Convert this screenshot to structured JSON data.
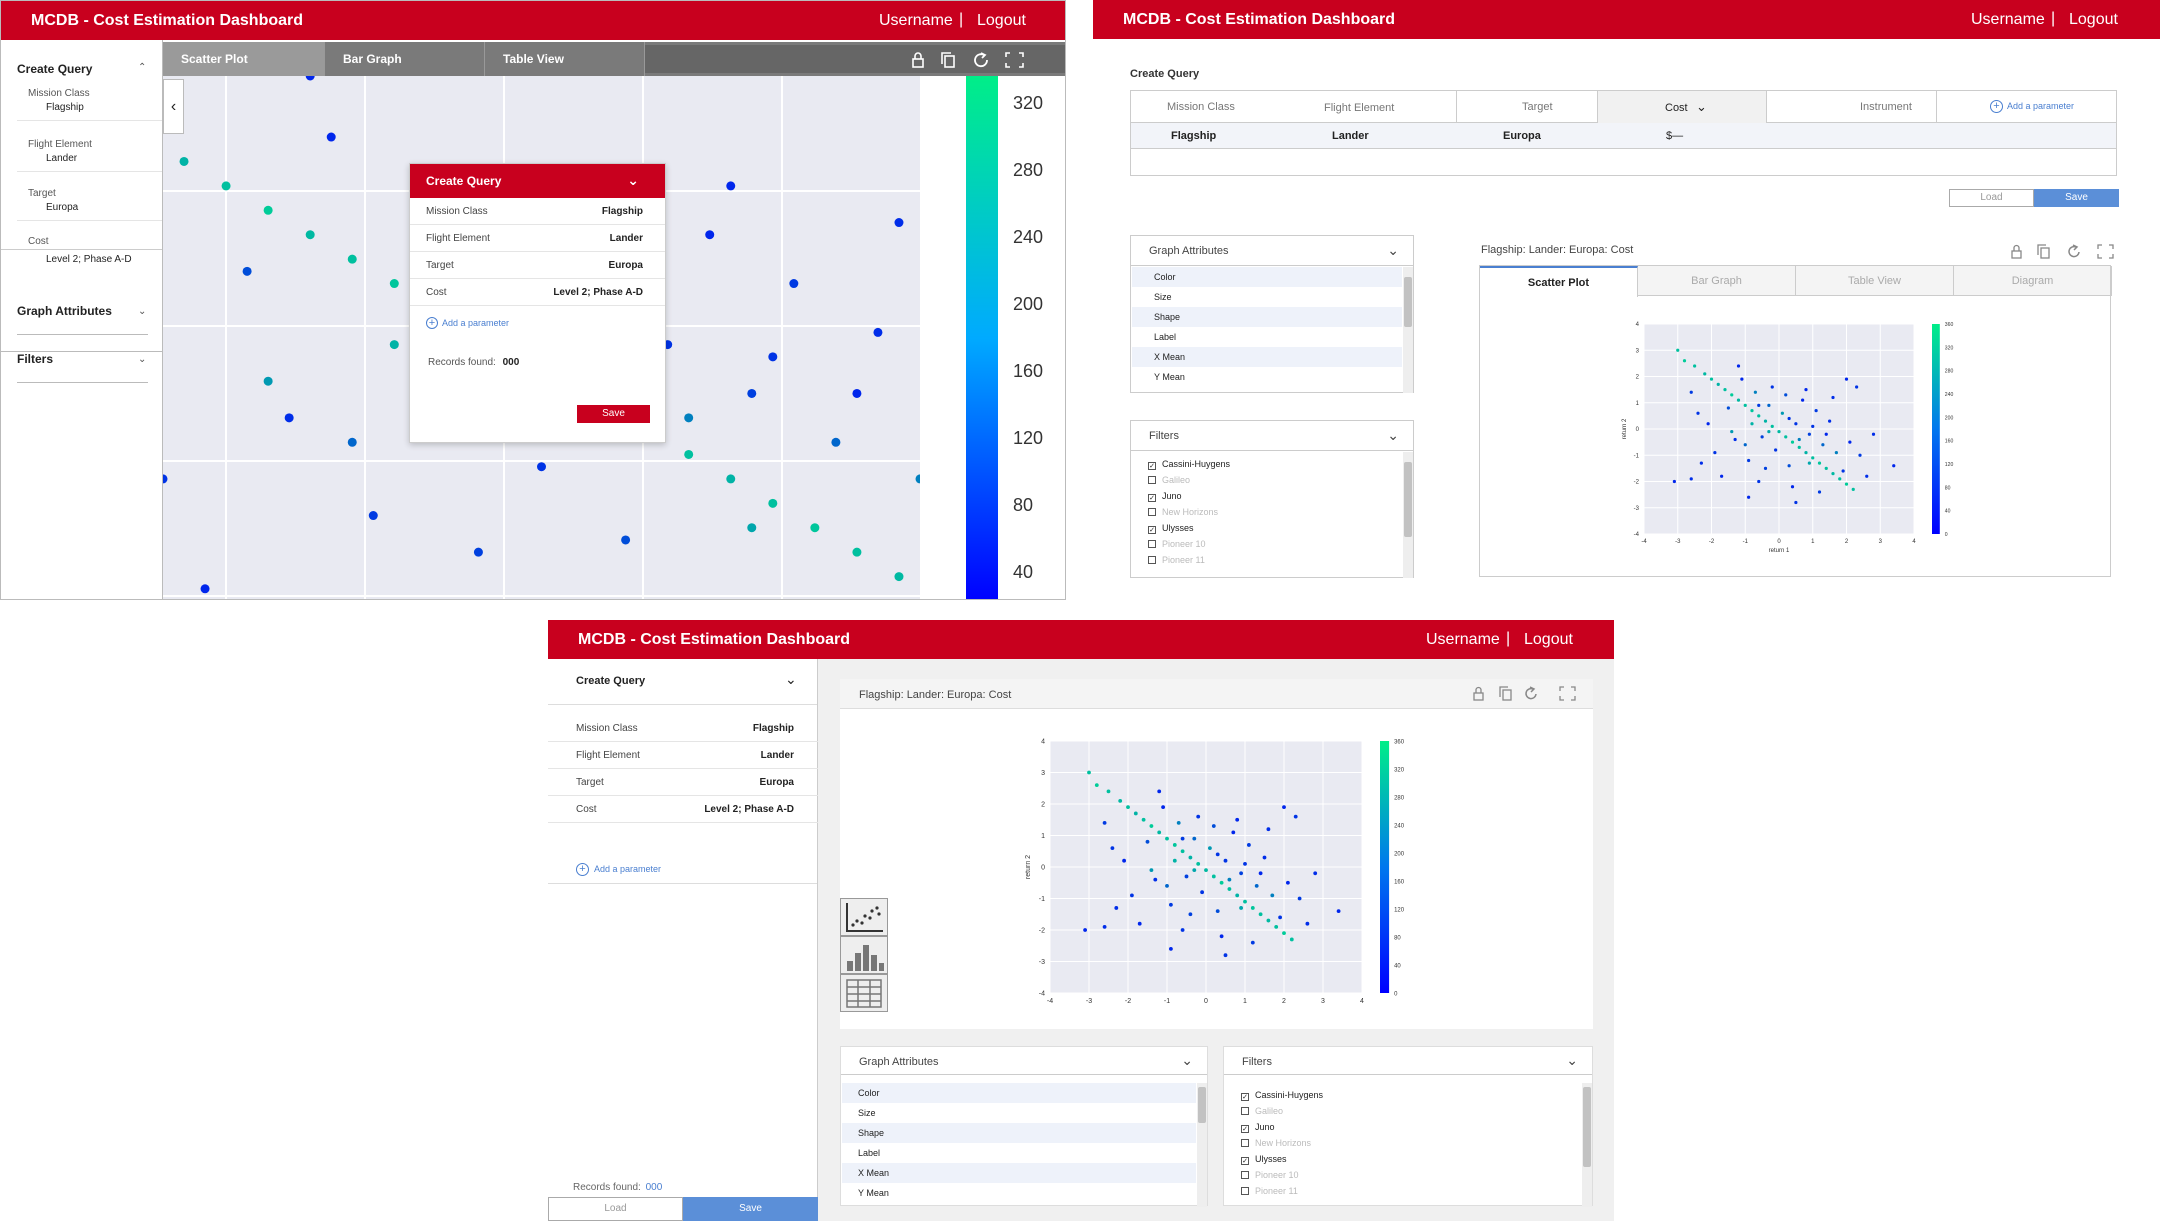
{
  "app": {
    "title": "MCDB - Cost Estimation Dashboard",
    "username": "Username",
    "logout": "Logout",
    "sep": "|"
  },
  "icons": [
    "lock-icon",
    "copy-icon",
    "refresh-icon",
    "fullscreen-icon",
    "chevron-down-icon",
    "chevron-up-icon",
    "chevron-left-icon",
    "plus-circle-icon",
    "scatter-plot-icon",
    "bar-graph-icon",
    "table-view-icon"
  ],
  "colors": {
    "brand": "#c8001e",
    "accent": "#5b8fd8",
    "cmap_low": "#0000ff",
    "cmap_high": "#00ee88"
  },
  "panel1": {
    "sidebar": {
      "create_query": "Create Query",
      "fields": [
        {
          "label": "Mission Class",
          "value": "Flagship"
        },
        {
          "label": "Flight Element",
          "value": "Lander"
        },
        {
          "label": "Target",
          "value": "Europa"
        },
        {
          "label": "Cost",
          "value": "Level 2; Phase A-D"
        }
      ],
      "graph_attributes": "Graph Attributes",
      "filters": "Filters"
    },
    "tabs": [
      "Scatter Plot",
      "Bar Graph",
      "Table View"
    ],
    "colorbar_ticks": [
      "320",
      "280",
      "240",
      "200",
      "160",
      "120",
      "80",
      "40"
    ],
    "popup": {
      "title": "Create Query",
      "rows": [
        {
          "label": "Mission Class",
          "value": "Flagship"
        },
        {
          "label": "Flight Element",
          "value": "Lander"
        },
        {
          "label": "Target",
          "value": "Europa"
        },
        {
          "label": "Cost",
          "value": "Level 2; Phase A-D"
        }
      ],
      "add_parameter": "Add a parameter",
      "records_label": "Records found:",
      "records_value": "000",
      "save": "Save"
    }
  },
  "panel2": {
    "create_query": "Create Query",
    "headers": [
      "Mission Class",
      "Flight Element",
      "Target",
      "Cost",
      "Instrument"
    ],
    "add_parameter": "Add a parameter",
    "row": [
      "Flagship",
      "Lander",
      "Europa",
      "$—"
    ],
    "load": "Load",
    "save": "Save",
    "graph_attributes": {
      "title": "Graph Attributes",
      "items": [
        "Color",
        "Size",
        "Shape",
        "Label",
        "X Mean",
        "Y Mean"
      ]
    },
    "filters": {
      "title": "Filters",
      "items": [
        {
          "label": "Cassini-Huygens",
          "checked": true
        },
        {
          "label": "Galileo",
          "checked": false
        },
        {
          "label": "Juno",
          "checked": true
        },
        {
          "label": "New Horizons",
          "checked": false
        },
        {
          "label": "Ulysses",
          "checked": true
        },
        {
          "label": "Pioneer 10",
          "checked": false
        },
        {
          "label": "Pioneer 11",
          "checked": false
        }
      ]
    },
    "chart_title": "Flagship:  Lander:  Europa:  Cost",
    "tabs": [
      "Scatter Plot",
      "Bar Graph",
      "Table View",
      "Diagram"
    ]
  },
  "panel3": {
    "create_query": "Create Query",
    "fields": [
      {
        "label": "Mission Class",
        "value": "Flagship"
      },
      {
        "label": "Flight Element",
        "value": "Lander"
      },
      {
        "label": "Target",
        "value": "Europa"
      },
      {
        "label": "Cost",
        "value": "Level 2; Phase A-D"
      }
    ],
    "add_parameter": "Add a parameter",
    "records_label": "Records found:",
    "records_value": "000",
    "load": "Load",
    "save": "Save",
    "chart_title": "Flagship:  Lander:  Europa:  Cost",
    "graph_attributes": {
      "title": "Graph Attributes",
      "items": [
        "Color",
        "Size",
        "Shape",
        "Label",
        "X Mean",
        "Y Mean"
      ]
    },
    "filters": {
      "title": "Filters",
      "items": [
        {
          "label": "Cassini-Huygens",
          "checked": true
        },
        {
          "label": "Galileo",
          "checked": false
        },
        {
          "label": "Juno",
          "checked": true
        },
        {
          "label": "New Horizons",
          "checked": false
        },
        {
          "label": "Ulysses",
          "checked": true
        },
        {
          "label": "Pioneer 10",
          "checked": false
        },
        {
          "label": "Pioneer 11",
          "checked": false
        }
      ]
    }
  },
  "chart_data": [
    {
      "type": "scatter",
      "xlabel": "return 1",
      "ylabel": "return 2",
      "xlim": [
        -4,
        4
      ],
      "ylim": [
        -4,
        4
      ],
      "xticks": [
        "-4",
        "-3",
        "-2",
        "-1",
        "0",
        "1",
        "2",
        "3",
        "4"
      ],
      "yticks": [
        "4",
        "3",
        "2",
        "1",
        "0",
        "-1",
        "-2",
        "-3",
        "-4"
      ],
      "color_scale": {
        "min": 0,
        "max": 360,
        "ticks": [
          "360",
          "320",
          "280",
          "240",
          "200",
          "160",
          "120",
          "80",
          "40",
          "0"
        ]
      },
      "grid": true,
      "points": [
        [
          -3.0,
          3.0,
          300
        ],
        [
          -2.8,
          2.6,
          320
        ],
        [
          -2.5,
          2.4,
          300
        ],
        [
          -2.2,
          2.1,
          290
        ],
        [
          -2.0,
          1.9,
          300
        ],
        [
          -1.8,
          1.7,
          280
        ],
        [
          -1.6,
          1.5,
          300
        ],
        [
          -1.4,
          1.3,
          320
        ],
        [
          -1.2,
          1.1,
          290
        ],
        [
          -1.0,
          0.9,
          300
        ],
        [
          -0.8,
          0.7,
          310
        ],
        [
          -0.6,
          0.5,
          300
        ],
        [
          -0.4,
          0.3,
          280
        ],
        [
          -0.2,
          0.1,
          300
        ],
        [
          0.0,
          -0.1,
          290
        ],
        [
          0.2,
          -0.3,
          300
        ],
        [
          0.4,
          -0.5,
          320
        ],
        [
          0.6,
          -0.7,
          300
        ],
        [
          0.8,
          -0.9,
          280
        ],
        [
          1.0,
          -1.1,
          300
        ],
        [
          1.2,
          -1.3,
          310
        ],
        [
          1.4,
          -1.5,
          300
        ],
        [
          1.6,
          -1.7,
          290
        ],
        [
          1.8,
          -1.9,
          300
        ],
        [
          2.0,
          -2.1,
          320
        ],
        [
          2.2,
          -2.3,
          300
        ],
        [
          -2.6,
          1.4,
          90
        ],
        [
          -2.1,
          0.2,
          60
        ],
        [
          -1.9,
          -0.9,
          80
        ],
        [
          -1.5,
          0.8,
          120
        ],
        [
          -1.3,
          -0.4,
          70
        ],
        [
          -1.1,
          1.9,
          60
        ],
        [
          -0.9,
          -1.2,
          90
        ],
        [
          -0.7,
          1.4,
          200
        ],
        [
          -0.5,
          -0.3,
          100
        ],
        [
          -0.3,
          0.9,
          160
        ],
        [
          -0.1,
          -0.8,
          80
        ],
        [
          0.1,
          0.6,
          240
        ],
        [
          0.3,
          -1.4,
          120
        ],
        [
          0.5,
          0.2,
          80
        ],
        [
          0.7,
          1.1,
          60
        ],
        [
          0.9,
          -0.2,
          100
        ],
        [
          1.1,
          0.7,
          90
        ],
        [
          1.3,
          -0.6,
          160
        ],
        [
          1.5,
          0.3,
          70
        ],
        [
          1.7,
          -0.9,
          200
        ],
        [
          1.9,
          -1.6,
          80
        ],
        [
          2.1,
          -0.5,
          60
        ],
        [
          2.4,
          -1.0,
          90
        ],
        [
          2.6,
          -1.8,
          70
        ],
        [
          -1.7,
          -1.8,
          60
        ],
        [
          -0.6,
          -2.0,
          80
        ],
        [
          0.4,
          -2.2,
          60
        ],
        [
          1.2,
          -2.4,
          90
        ],
        [
          -2.3,
          -1.3,
          70
        ],
        [
          -0.2,
          1.6,
          80
        ],
        [
          0.8,
          1.5,
          60
        ],
        [
          1.6,
          1.2,
          70
        ],
        [
          -1.4,
          -0.1,
          240
        ],
        [
          -0.4,
          -1.5,
          100
        ],
        [
          0.2,
          1.3,
          120
        ],
        [
          0.6,
          -0.4,
          200
        ],
        [
          -0.8,
          0.2,
          280
        ],
        [
          -1.0,
          -0.6,
          160
        ],
        [
          1.0,
          0.1,
          80
        ],
        [
          -0.3,
          -0.1,
          260
        ],
        [
          0.3,
          0.4,
          80
        ],
        [
          -0.6,
          0.9,
          90
        ],
        [
          0.9,
          -1.3,
          260
        ],
        [
          1.4,
          -0.2,
          60
        ],
        [
          -2.4,
          0.6,
          80
        ],
        [
          -1.2,
          2.4,
          60
        ],
        [
          2.8,
          -0.2,
          70
        ],
        [
          3.4,
          -1.4,
          60
        ],
        [
          -3.1,
          -2.0,
          60
        ],
        [
          -2.6,
          -1.9,
          70
        ],
        [
          2.0,
          1.9,
          60
        ],
        [
          2.3,
          1.6,
          80
        ],
        [
          -0.9,
          -2.6,
          60
        ],
        [
          0.5,
          -2.8,
          80
        ]
      ]
    }
  ]
}
